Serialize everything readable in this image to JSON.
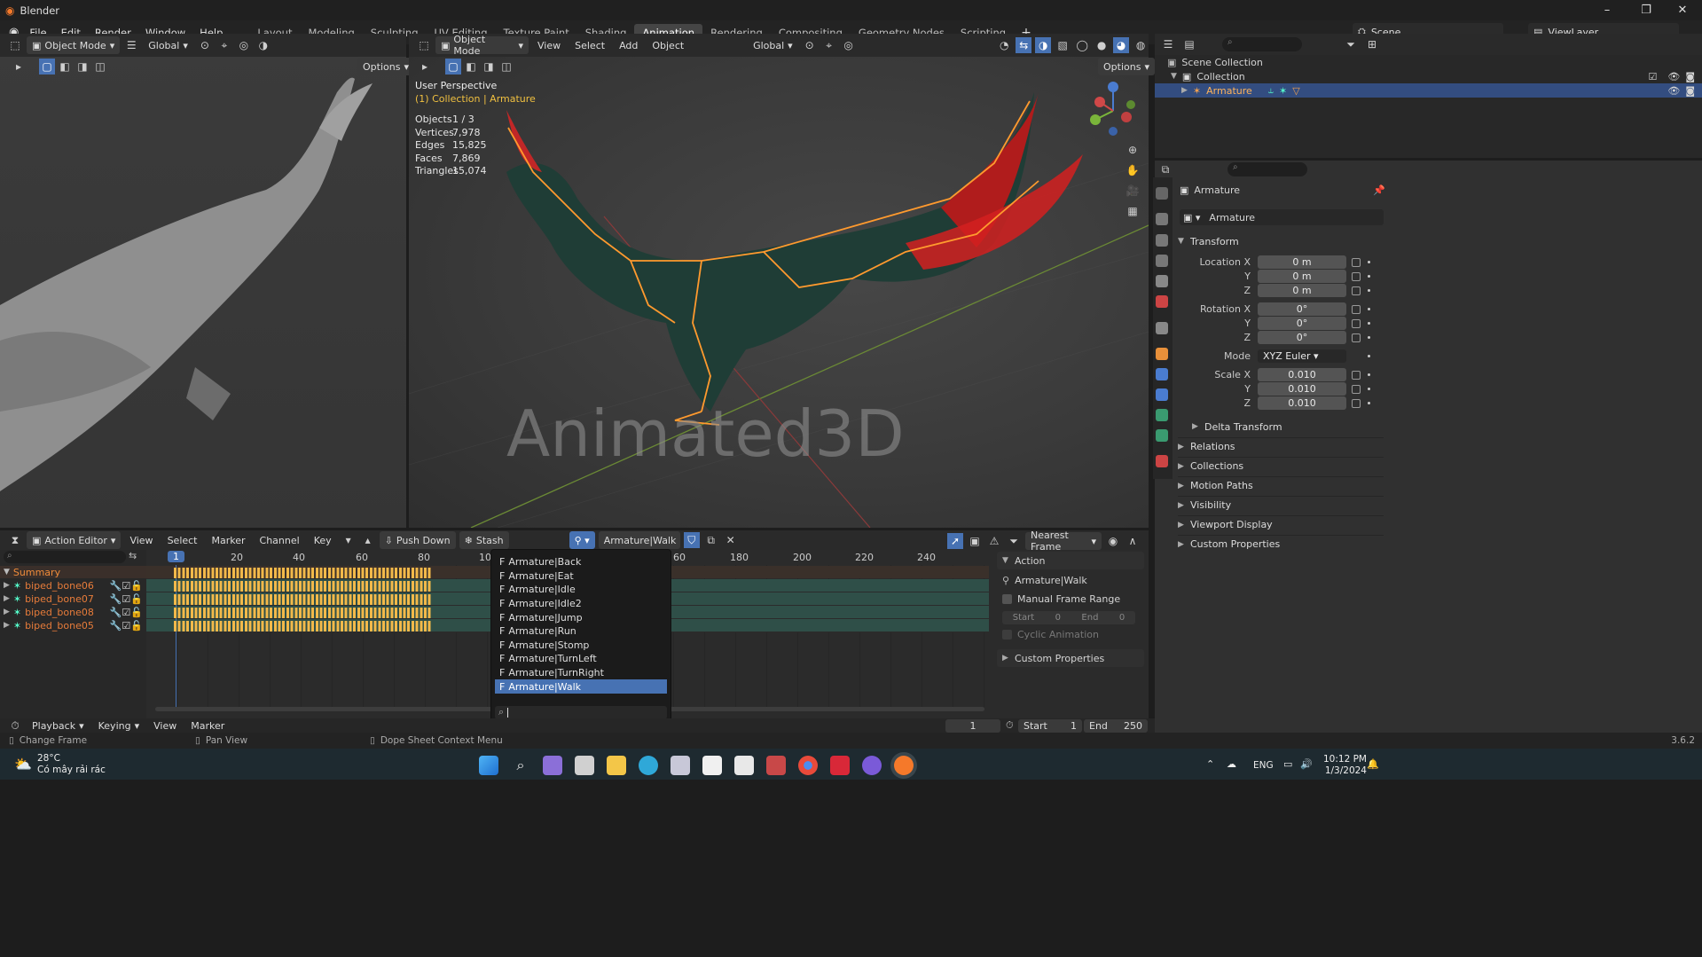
{
  "app": {
    "title": "Blender",
    "version": "3.6.2"
  },
  "menus": [
    "File",
    "Edit",
    "Render",
    "Window",
    "Help"
  ],
  "workspaces": [
    {
      "label": "Layout"
    },
    {
      "label": "Modeling"
    },
    {
      "label": "Sculpting"
    },
    {
      "label": "UV Editing"
    },
    {
      "label": "Texture Paint"
    },
    {
      "label": "Shading"
    },
    {
      "label": "Animation",
      "active": true
    },
    {
      "label": "Rendering"
    },
    {
      "label": "Compositing"
    },
    {
      "label": "Geometry Nodes"
    },
    {
      "label": "Scripting"
    }
  ],
  "scene": {
    "name": "Scene",
    "view_layer": "ViewLayer"
  },
  "left_viewport": {
    "mode": "Object Mode",
    "transform": "Global",
    "options": "Options"
  },
  "main_viewport": {
    "mode": "Object Mode",
    "menu": [
      "View",
      "Select",
      "Add",
      "Object"
    ],
    "transform": "Global",
    "options": "Options",
    "perspective": "User Perspective",
    "collection_line": "(1) Collection | Armature",
    "stats": [
      {
        "k": "Objects",
        "v": "1 / 3"
      },
      {
        "k": "Vertices",
        "v": "7,978"
      },
      {
        "k": "Edges",
        "v": "15,825"
      },
      {
        "k": "Faces",
        "v": "7,869"
      },
      {
        "k": "Triangles",
        "v": "15,074"
      }
    ],
    "watermark": "Animated3D"
  },
  "outliner": {
    "root": "Scene Collection",
    "collection": "Collection",
    "armature": "Armature"
  },
  "properties": {
    "object_name": "Armature",
    "data_name": "Armature",
    "transform_label": "Transform",
    "location": [
      {
        "label": "Location X",
        "v": "0 m"
      },
      {
        "label": "Y",
        "v": "0 m"
      },
      {
        "label": "Z",
        "v": "0 m"
      }
    ],
    "rotation": [
      {
        "label": "Rotation X",
        "v": "0°"
      },
      {
        "label": "Y",
        "v": "0°"
      },
      {
        "label": "Z",
        "v": "0°"
      }
    ],
    "mode_label": "Mode",
    "mode_value": "XYZ Euler",
    "scale": [
      {
        "label": "Scale X",
        "v": "0.010"
      },
      {
        "label": "Y",
        "v": "0.010"
      },
      {
        "label": "Z",
        "v": "0.010"
      }
    ],
    "delta": "Delta Transform",
    "sections": [
      "Relations",
      "Collections",
      "Motion Paths",
      "Visibility",
      "Viewport Display",
      "Custom Properties"
    ]
  },
  "dopesheet": {
    "editor": "Action Editor",
    "menu": [
      "View",
      "Select",
      "Marker",
      "Channel",
      "Key"
    ],
    "push_down": "Push Down",
    "stash": "Stash",
    "action": "Armature|Walk",
    "snap": "Nearest Frame",
    "current_frame_badge": "1",
    "ruler": [
      "20",
      "40",
      "60",
      "80",
      "10",
      "60",
      "180",
      "200",
      "220",
      "240"
    ],
    "summary": "Summary",
    "channels": [
      "biped_bone06",
      "biped_bone07",
      "biped_bone08",
      "biped_bone05"
    ]
  },
  "action_dropdown": {
    "items": [
      "Armature|Back",
      "Armature|Eat",
      "Armature|Idle",
      "Armature|Idle2",
      "Armature|Jump",
      "Armature|Run",
      "Armature|Stomp",
      "Armature|TurnLeft",
      "Armature|TurnRight",
      "Armature|Walk"
    ],
    "selected": "Armature|Walk",
    "prefix": "F"
  },
  "action_panel": {
    "title": "Action",
    "name": "Armature|Walk",
    "manual_range": "Manual Frame Range",
    "start_label": "Start",
    "start_v": "0",
    "end_label": "End",
    "end_v": "0",
    "cyclic": "Cyclic Animation",
    "custom": "Custom Properties"
  },
  "timeline": {
    "menu": [
      "Playback",
      "Keying",
      "View",
      "Marker"
    ],
    "frame": "1",
    "start_label": "Start",
    "start": "1",
    "end_label": "End",
    "end": "250"
  },
  "statusbar": {
    "items": [
      "Change Frame",
      "Pan View",
      "Dope Sheet Context Menu"
    ]
  },
  "taskbar": {
    "temp": "28°C",
    "weather": "Có mây rải rác",
    "lang": "ENG",
    "time": "10:12 PM",
    "date": "1/3/2024"
  }
}
